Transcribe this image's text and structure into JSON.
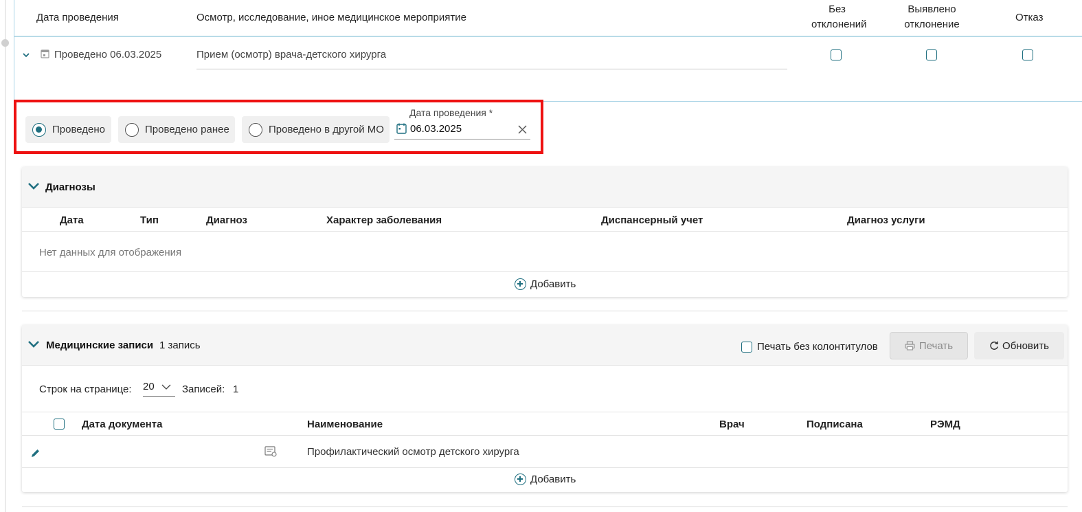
{
  "top_table": {
    "headers": {
      "date": "Дата проведения",
      "exam": "Осмотр, исследование, иное медицинское мероприятие",
      "no_deviation_1": "Без",
      "no_deviation_2": "отклонений",
      "deviation_1": "Выявлено",
      "deviation_2": "отклонение",
      "refusal": "Отказ"
    },
    "row": {
      "date_text": "Проведено 06.03.2025",
      "exam_name": "Прием (осмотр) врача-детского хирурга"
    }
  },
  "status": {
    "options": [
      {
        "label": "Проведено",
        "selected": true
      },
      {
        "label": "Проведено ранее",
        "selected": false
      },
      {
        "label": "Проведено в другой МО",
        "selected": false
      }
    ],
    "date_label": "Дата проведения *",
    "date_value": "06.03.2025"
  },
  "diagnoses": {
    "title": "Диагнозы",
    "columns": [
      "Дата",
      "Тип",
      "Диагноз",
      "Характер заболевания",
      "Диспансерный учет",
      "Диагноз услуги"
    ],
    "empty_text": "Нет данных для отображения",
    "add_label": "Добавить"
  },
  "med_records": {
    "title": "Медицинские записи",
    "count_text": "1 запись",
    "print_no_headers_label": "Печать без колонтитулов",
    "print_label": "Печать",
    "refresh_label": "Обновить",
    "rows_per_page_label": "Строк на странице:",
    "rows_per_page_value": "20",
    "records_label": "Записей:",
    "records_value": "1",
    "columns": [
      "Дата документа",
      "Наименование",
      "Врач",
      "Подписана",
      "РЭМД"
    ],
    "rows": [
      {
        "date": "",
        "name": "Профилактический осмотр детского хирурга",
        "doctor": "",
        "signed": "",
        "remd": ""
      }
    ],
    "add_label": "Добавить"
  },
  "colors": {
    "accent": "#1f6f80",
    "highlight": "#ee1111"
  }
}
